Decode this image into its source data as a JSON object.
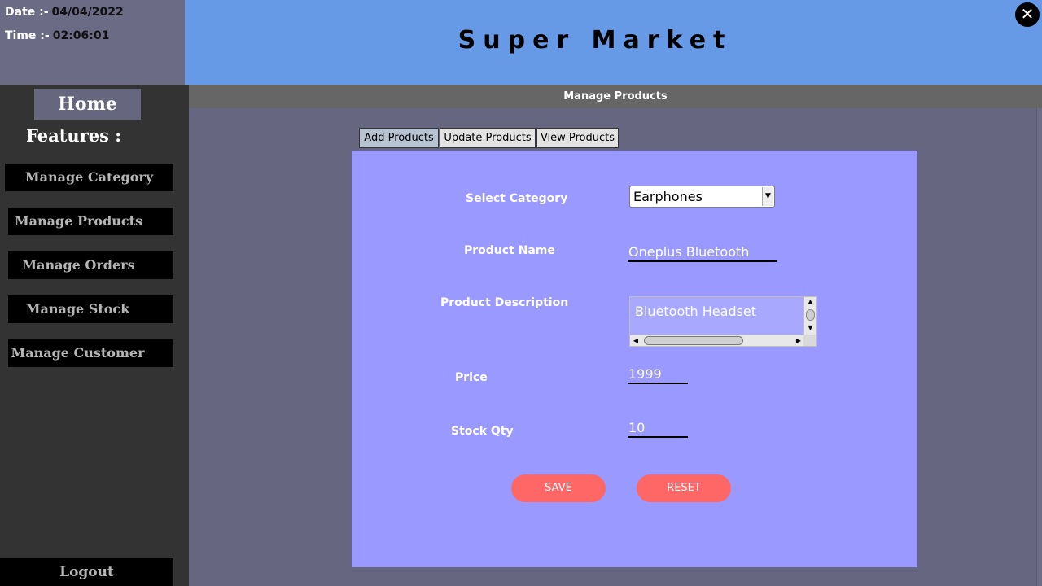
{
  "datetime": {
    "date_label": "Date :-",
    "date_value": "04/04/2022",
    "time_label": "Time :-",
    "time_value": "02:06:01"
  },
  "header": {
    "title": "Super Market",
    "close_glyph": "✕",
    "close_icon": "close-icon"
  },
  "sidebar": {
    "home_label": "Home",
    "features_label": "Features :",
    "items": [
      {
        "label": "Manage Category"
      },
      {
        "label": "Manage Products"
      },
      {
        "label": "Manage Orders"
      },
      {
        "label": "Manage Stock"
      },
      {
        "label": "Manage Customer"
      }
    ],
    "logout_label": "Logout"
  },
  "main": {
    "section_title": "Manage Products",
    "tabs": [
      {
        "label": "Add Products",
        "active": true
      },
      {
        "label": "Update Products",
        "active": false
      },
      {
        "label": "View Products",
        "active": false
      }
    ],
    "form": {
      "category_label": "Select Category",
      "category_value": "Earphones",
      "name_label": "Product Name",
      "name_value": "Oneplus Bluetooth",
      "description_label": "Product Description",
      "description_value": "Bluetooth Headset",
      "price_label": "Price",
      "price_value": "1999",
      "stock_label": "Stock Qty",
      "stock_value": "10"
    },
    "buttons": {
      "save_label": "SAVE",
      "reset_label": "RESET"
    }
  },
  "colors": {
    "header_bg": "#6699e6",
    "panel_bg": "#9a99ff",
    "button_bg": "#ff6666",
    "sidebar_bg": "#333333"
  }
}
